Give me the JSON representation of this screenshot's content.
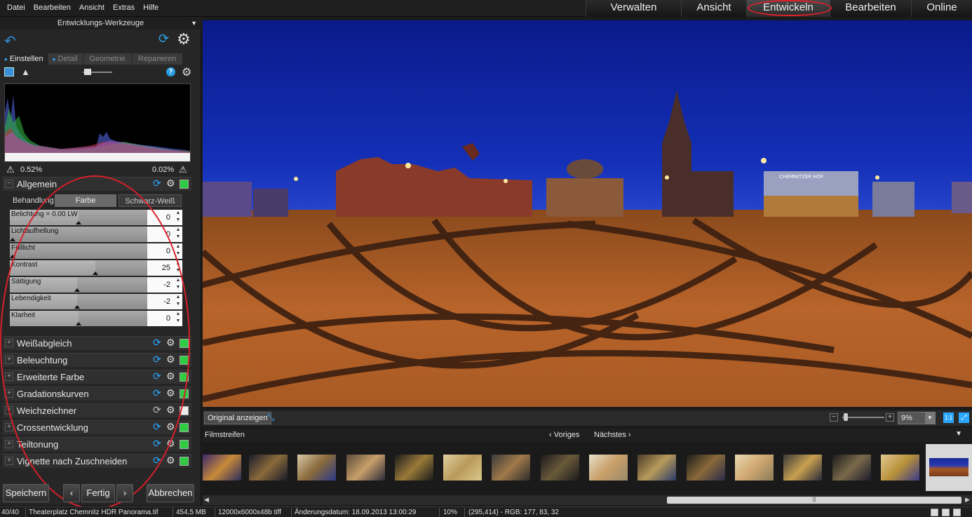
{
  "menu": [
    "Datei",
    "Bearbeiten",
    "Ansicht",
    "Extras",
    "Hilfe"
  ],
  "modes": [
    "Verwalten",
    "Ansicht",
    "Entwickeln",
    "Bearbeiten",
    "Online"
  ],
  "active_mode": "Entwickeln",
  "panel": {
    "title": "Entwicklungs-Werkzeuge",
    "tabs": [
      "Einstellen",
      "Detail",
      "Geometrie",
      "Reparieren"
    ],
    "clip_low": "0.52%",
    "clip_high": "0.02%",
    "general": {
      "title": "Allgemein",
      "treatment_label": "Behandlung:",
      "treatment_options": [
        "Farbe",
        "Schwarz-Weiß"
      ],
      "sliders": [
        {
          "name": "Belichtung = 0.00 LW",
          "value": "0",
          "fraction": 0.5
        },
        {
          "name": "Lichtaufhellung",
          "value": "0",
          "fraction": 0.0
        },
        {
          "name": "Fülllicht",
          "value": "0",
          "fraction": 0.0
        },
        {
          "name": "Kontrast",
          "value": "25",
          "fraction": 0.62
        },
        {
          "name": "Sättigung",
          "value": "-2",
          "fraction": 0.49
        },
        {
          "name": "Lebendigkeit",
          "value": "-2",
          "fraction": 0.49
        },
        {
          "name": "Klarheit",
          "value": "0",
          "fraction": 0.5
        }
      ]
    },
    "sections": [
      "Weißabgleich",
      "Beleuchtung",
      "Erweiterte Farbe",
      "Gradationskurven",
      "Weichzeichner",
      "Crossentwicklung",
      "Teiltonung",
      "Vignette nach Zuschneiden"
    ],
    "buttons": {
      "save": "Speichern",
      "done": "Fertig",
      "cancel": "Abbrechen"
    }
  },
  "viewer": {
    "original_button": "Original anzeigen",
    "zoom": "9%",
    "zoom_11": "1:1"
  },
  "filmstrip": {
    "title": "Filmstreifen",
    "prev": "Voriges",
    "next": "Nächstes"
  },
  "status": {
    "count": "40/40",
    "filename": "Theaterplatz Chemnitz HDR Panorama.tif",
    "size": "454,5 MB",
    "dims": "12000x6000x48b tiff",
    "date": "Änderungsdatum: 18.09.2013 13:00:29",
    "zoom": "10%",
    "pixel": "(295,414) - RGB: 177, 83, 32"
  },
  "image_sign": "CHEMNITZER HOF",
  "colors": {
    "accent": "#2aa7ff",
    "highlight_ring": "#d8202a",
    "enabled": "#2ecc40"
  }
}
